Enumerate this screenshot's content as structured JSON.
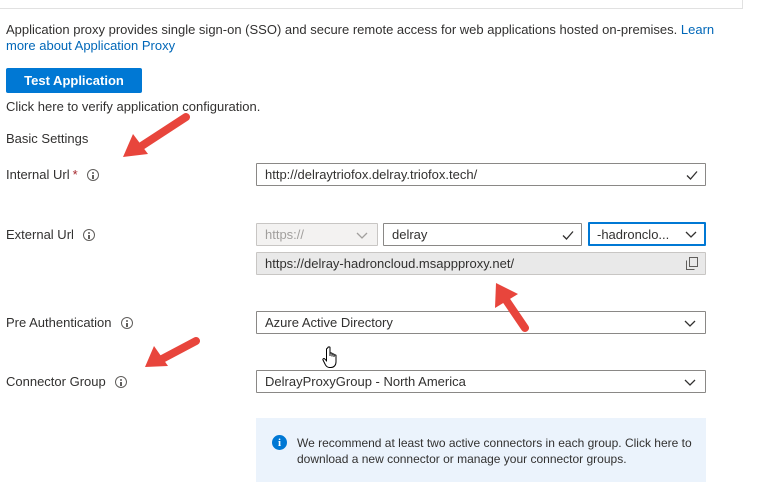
{
  "description": {
    "text": "Application proxy provides single sign-on (SSO) and secure remote access for web applications hosted on-premises.",
    "link": "Learn more about Application Proxy"
  },
  "test_button": {
    "label": "Test Application"
  },
  "helper_text": "Click here to verify application configuration.",
  "section_title": "Basic Settings",
  "internal_url": {
    "label": "Internal Url",
    "required_mark": "*",
    "value": "http://delraytriofox.delray.triofox.tech/"
  },
  "external_url": {
    "label": "External Url",
    "scheme": "https://",
    "subdomain": "delray",
    "domain": "-hadronclo...",
    "full_url": "https://delray-hadroncloud.msappproxy.net/"
  },
  "pre_authentication": {
    "label": "Pre Authentication",
    "value": "Azure Active Directory"
  },
  "connector_group": {
    "label": "Connector Group",
    "value": "DelrayProxyGroup - North America"
  },
  "info_message": "We recommend at least two active connectors in each group. Click here to download a new connector or manage your connector groups.",
  "colors": {
    "primary": "#0078d4",
    "link": "#0067b8",
    "required": "#a4262c",
    "annotation_arrow": "#e8453c",
    "info_bg": "#ebf3fc"
  },
  "icons": {
    "info": "info-circle-icon",
    "valid": "checkmark-icon",
    "dropdown": "chevron-down-icon",
    "copy": "copy-icon",
    "message": "info-filled-icon",
    "pointer": "hand-pointer-cursor"
  }
}
